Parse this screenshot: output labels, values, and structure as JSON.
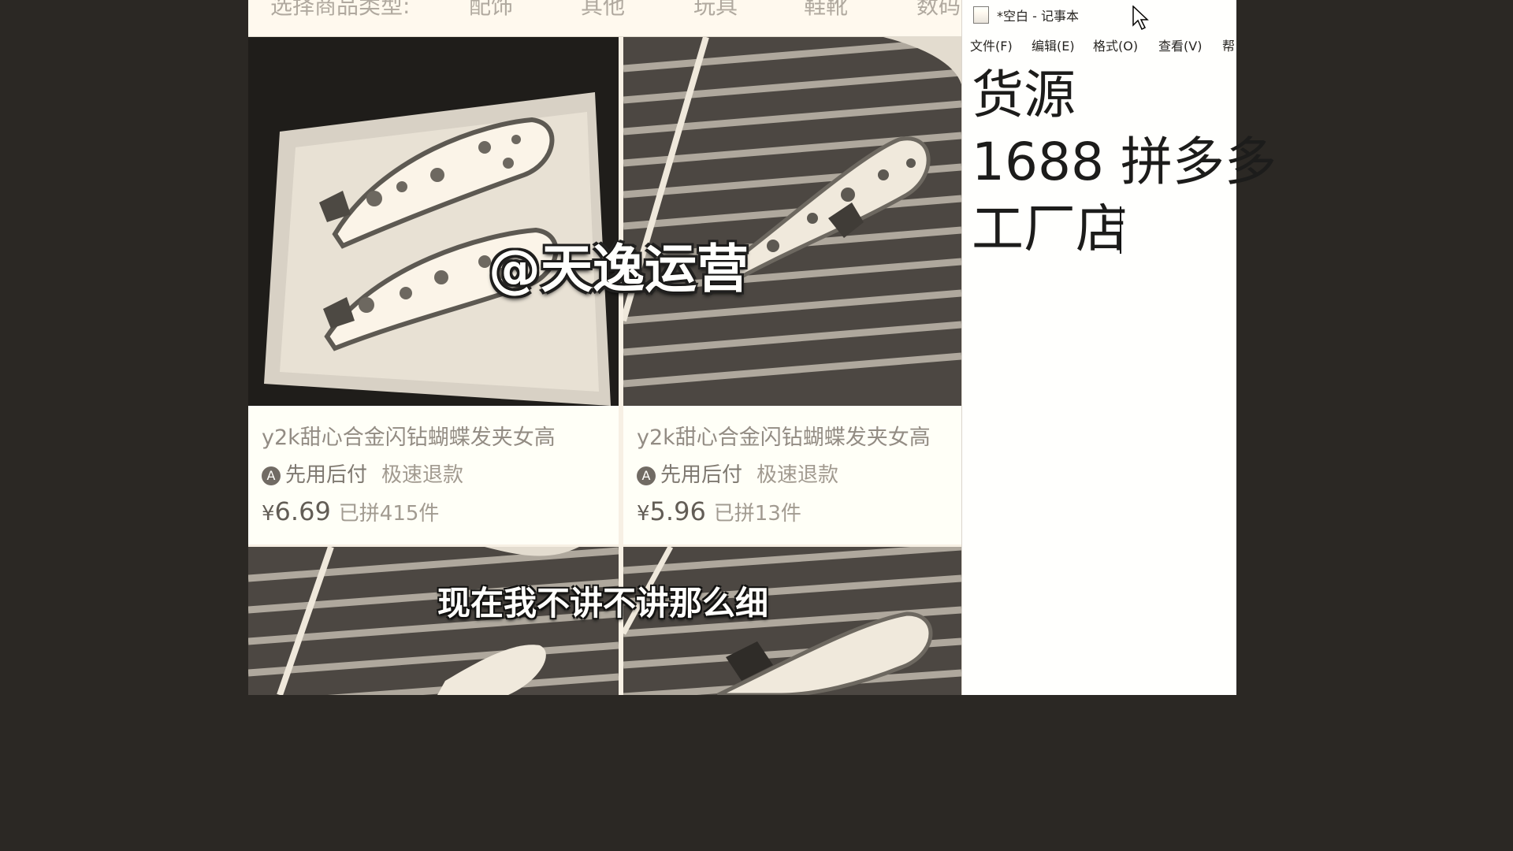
{
  "shop": {
    "category_prefix": "选择商品类型:",
    "categories": [
      "配饰",
      "其他",
      "玩具",
      "鞋靴",
      "数码"
    ],
    "products": [
      {
        "title": "y2k甜心合金闪钻蝴蝶发夹女高",
        "badge_icon": "A",
        "badge_label": "先用后付",
        "refund_label": "极速退款",
        "currency": "¥",
        "price": "6.69",
        "sold": "已拼415件"
      },
      {
        "title": "y2k甜心合金闪钻蝴蝶发夹女高",
        "badge_icon": "A",
        "badge_label": "先用后付",
        "refund_label": "极速退款",
        "currency": "¥",
        "price": "5.96",
        "sold": "已拼13件"
      }
    ]
  },
  "notepad": {
    "window_title": "*空白 - 记事本",
    "menu": [
      "文件(F)",
      "编辑(E)",
      "格式(O)",
      "查看(V)",
      "帮"
    ],
    "lines": [
      "货源",
      "1688 拼多多",
      "工厂店"
    ]
  },
  "overlay": {
    "watermark": "@天逸运营",
    "subtitle": "现在我不讲不讲那么细"
  },
  "icons": {
    "notepad_app": "notepad-icon",
    "cursor": "mouse-pointer-icon",
    "payment_badge": "pay-later-badge-icon"
  }
}
